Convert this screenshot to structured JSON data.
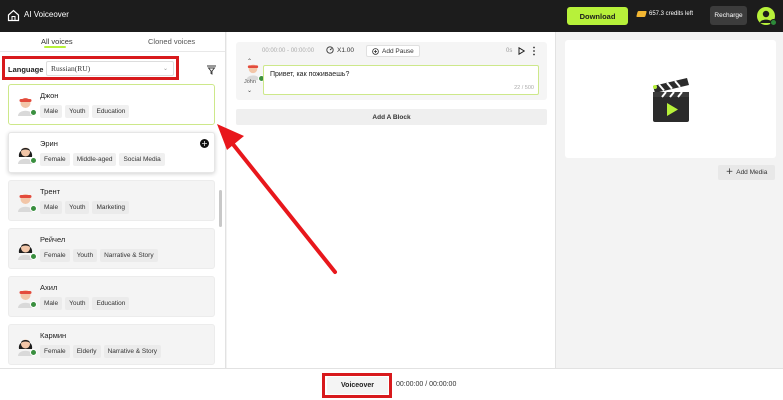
{
  "topbar": {
    "app_title": "AI Voiceover",
    "download_label": "Download",
    "credits_text": "657.3 credits left",
    "recharge_label": "Recharge"
  },
  "left_panel": {
    "tabs": [
      {
        "label": "All voices",
        "active": true
      },
      {
        "label": "Cloned voices",
        "active": false
      }
    ],
    "language_label": "Language",
    "language_value": "Russian(RU)",
    "voices": [
      {
        "name": "Джон",
        "tags": [
          "Male",
          "Youth",
          "Education"
        ],
        "state": "selected"
      },
      {
        "name": "Эрин",
        "tags": [
          "Female",
          "Middle-aged",
          "Social Media"
        ],
        "state": "hovered"
      },
      {
        "name": "Трент",
        "tags": [
          "Male",
          "Youth",
          "Marketing"
        ],
        "state": "normal"
      },
      {
        "name": "Рейчел",
        "tags": [
          "Female",
          "Youth",
          "Narrative & Story"
        ],
        "state": "normal"
      },
      {
        "name": "Ахил",
        "tags": [
          "Male",
          "Youth",
          "Education"
        ],
        "state": "normal"
      },
      {
        "name": "Кармин",
        "tags": [
          "Female",
          "Elderly",
          "Narrative & Story"
        ],
        "state": "normal"
      }
    ]
  },
  "editor": {
    "block": {
      "time_range": "00:00:00 - 00:00:00",
      "speed": "X1.00",
      "add_pause_label": "Add Pause",
      "duration": "0s",
      "voice_name": "John",
      "text": "Привет, как поживаешь?",
      "char_count": "22 / 500"
    },
    "add_block_label": "Add A Block"
  },
  "media": {
    "add_media_label": "Add Media"
  },
  "bottom": {
    "voiceover_label": "Voiceover",
    "total_time": "00:00:00 / 00:00:00"
  },
  "colors": {
    "accent": "#b7f13a",
    "highlight": "#d8191c",
    "topbar": "#1c1c1c",
    "badge": "#3a8f3f"
  }
}
